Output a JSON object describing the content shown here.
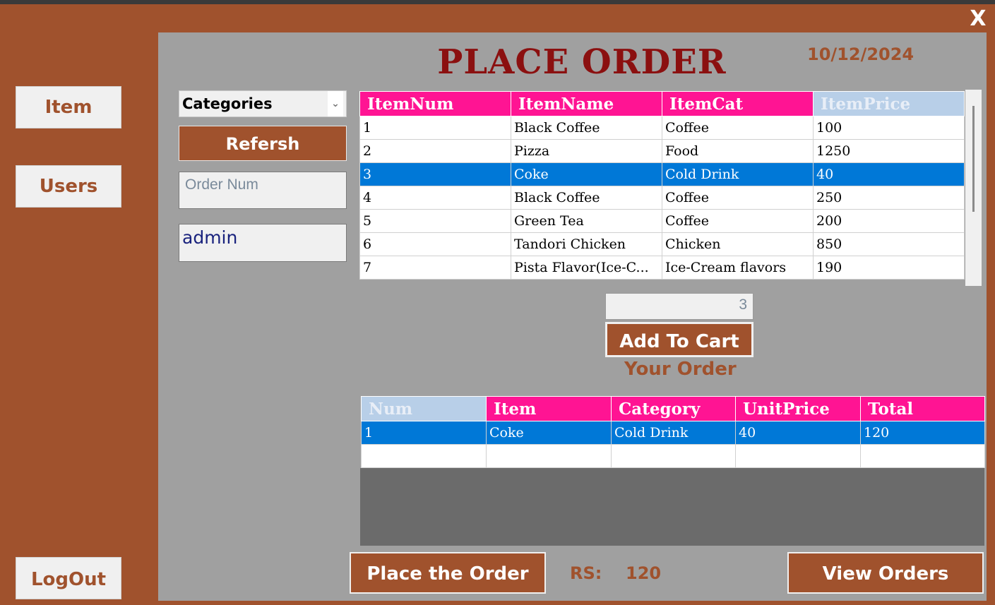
{
  "window": {
    "close_label": "X"
  },
  "sidebar": {
    "item_label": "Item",
    "users_label": "Users",
    "logout_label": "LogOut"
  },
  "header": {
    "title": "PLACE ORDER",
    "date": "10/12/2024"
  },
  "filters": {
    "category_selected": "Categories",
    "refresh_label": "Refersh",
    "order_num_placeholder": "Order Num",
    "user_value": "admin"
  },
  "items_table": {
    "columns": [
      "ItemNum",
      "ItemName",
      "ItemCat",
      "ItemPrice"
    ],
    "rows": [
      [
        "1",
        "Black Coffee",
        "Coffee",
        "100"
      ],
      [
        "2",
        "Pizza",
        "Food",
        "1250"
      ],
      [
        "3",
        "Coke",
        "Cold Drink",
        "40"
      ],
      [
        "4",
        "Black Coffee",
        "Coffee",
        "250"
      ],
      [
        "5",
        "Green Tea",
        "Coffee",
        "200"
      ],
      [
        "6",
        "Tandori Chicken",
        "Chicken",
        "850"
      ],
      [
        "7",
        "Pista Flavor(Ice-C...",
        "Ice-Cream flavors",
        "190"
      ]
    ]
  },
  "cart_controls": {
    "quantity_value": "3",
    "add_to_cart_label": "Add To Cart",
    "your_order_label": "Your Order"
  },
  "order_table": {
    "columns": [
      "Num",
      "Item",
      "Category",
      "UnitPrice",
      "Total"
    ],
    "rows": [
      [
        "1",
        "Coke",
        "Cold Drink",
        "40",
        "120"
      ]
    ]
  },
  "footer": {
    "place_order_label": "Place the Order",
    "rs_label": "RS:",
    "rs_value": "120",
    "view_orders_label": "View Orders"
  },
  "colors": {
    "brand_brown": "#a0522d",
    "header_pink": "#ff1493",
    "selection_blue": "#0078d7",
    "title_red": "#8b1010"
  }
}
